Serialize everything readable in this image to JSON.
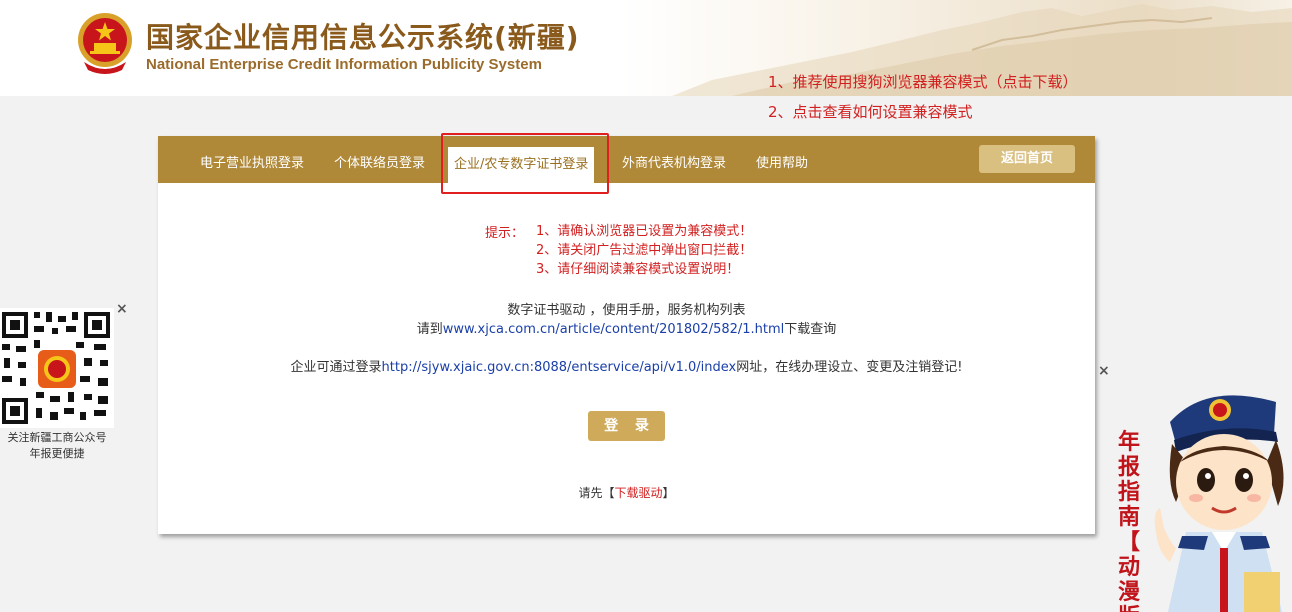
{
  "header": {
    "title_cn": "国家企业信用信息公示系统(新疆)",
    "title_en": "National Enterprise Credit Information Publicity System",
    "notice_links": [
      "1、推荐使用搜狗浏览器兼容模式（点击下载）",
      "2、点击查看如何设置兼容模式"
    ]
  },
  "tabs": [
    {
      "label": "电子营业执照登录",
      "active": false
    },
    {
      "label": "个体联络员登录",
      "active": false
    },
    {
      "label": "企业/农专数字证书登录",
      "active": true
    },
    {
      "label": "外商代表机构登录",
      "active": false
    },
    {
      "label": "使用帮助",
      "active": false
    }
  ],
  "home_button": "返回首页",
  "tips": {
    "label": "提示：",
    "items": [
      "1、请确认浏览器已设置为兼容模式！",
      "2、请关闭广告过滤中弹出窗口拦截！",
      "3、请仔细阅读兼容模式设置说明！"
    ]
  },
  "info": {
    "line1": "数字证书驱动 ，使用手册，服务机构列表",
    "line2_prefix": "请到",
    "line2_link": "www.xjca.com.cn/article/content/201802/582/1.html",
    "line2_suffix": "下载查询",
    "line3_prefix": "企业可通过登录",
    "line3_link": "http://sjyw.xjaic.gov.cn:8088/entservice/api/v1.0/index",
    "line3_suffix": "网址，在线办理设立、变更及注销登记!"
  },
  "login_button": "登 录",
  "driver": {
    "prefix": "请先【",
    "link": "下载驱动",
    "suffix": "】"
  },
  "qr": {
    "close": "×",
    "caption_lines": [
      "关注新疆工商公众号",
      "年报更便捷"
    ]
  },
  "mascot": {
    "close": "×",
    "vertical_text": [
      "年",
      "报",
      "指",
      "南",
      "【",
      "动",
      "漫",
      "版"
    ]
  },
  "colors": {
    "tab_bar": "#b08938",
    "home_button": "#d9bf80",
    "login_button": "#cfaa5b",
    "alert_red": "#d22020",
    "title_brown": "#8a5a1c",
    "link_blue": "#1a3fa8"
  }
}
